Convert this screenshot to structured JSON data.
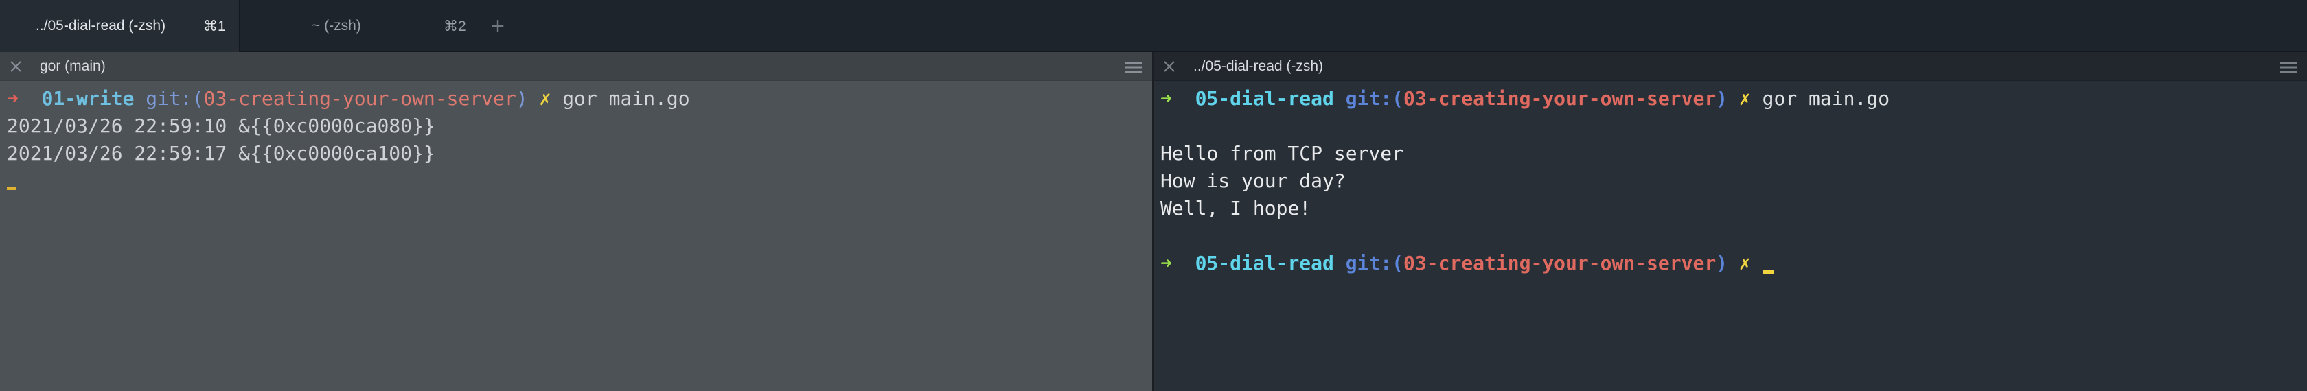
{
  "tabs": [
    {
      "title": "../05-dial-read (-zsh)",
      "shortcut": "⌘1",
      "active": true
    },
    {
      "title": "~ (-zsh)",
      "shortcut": "⌘2",
      "active": false
    }
  ],
  "new_tab_glyph": "+",
  "panes": {
    "left": {
      "title": "gor (main)",
      "prompt": {
        "arrow": "➜",
        "dir": "01-write",
        "git_prefix": "git:(",
        "branch": "03-creating-your-own-server",
        "git_suffix": ")",
        "dirty_mark": "✗",
        "command": "gor main.go"
      },
      "output": [
        "2021/03/26 22:59:10 &{{0xc0000ca080}}",
        "2021/03/26 22:59:17 &{{0xc0000ca100}}"
      ]
    },
    "right": {
      "title": "../05-dial-read (-zsh)",
      "prompt": {
        "arrow": "➜",
        "dir": "05-dial-read",
        "git_prefix": "git:(",
        "branch": "03-creating-your-own-server",
        "git_suffix": ")",
        "dirty_mark": "✗",
        "command": "gor main.go"
      },
      "output": [
        "Hello from TCP server",
        "How is your day?",
        "Well, I hope!"
      ],
      "prompt2": {
        "arrow": "➜",
        "dir": "05-dial-read",
        "git_prefix": "git:(",
        "branch": "03-creating-your-own-server",
        "git_suffix": ")",
        "dirty_mark": "✗"
      }
    }
  },
  "icons": {
    "close": "close-icon",
    "menu": "hamburger-menu-icon"
  },
  "colors": {
    "left_pane_bg": "#4d5257",
    "right_pane_bg": "#292f37",
    "dir": "#5fd4ea",
    "branch": "#e06a60",
    "git": "#5c84d8",
    "arrow_ok": "#9be04a",
    "arrow_err": "#e0605a",
    "dirty_mark": "#f0d540"
  }
}
